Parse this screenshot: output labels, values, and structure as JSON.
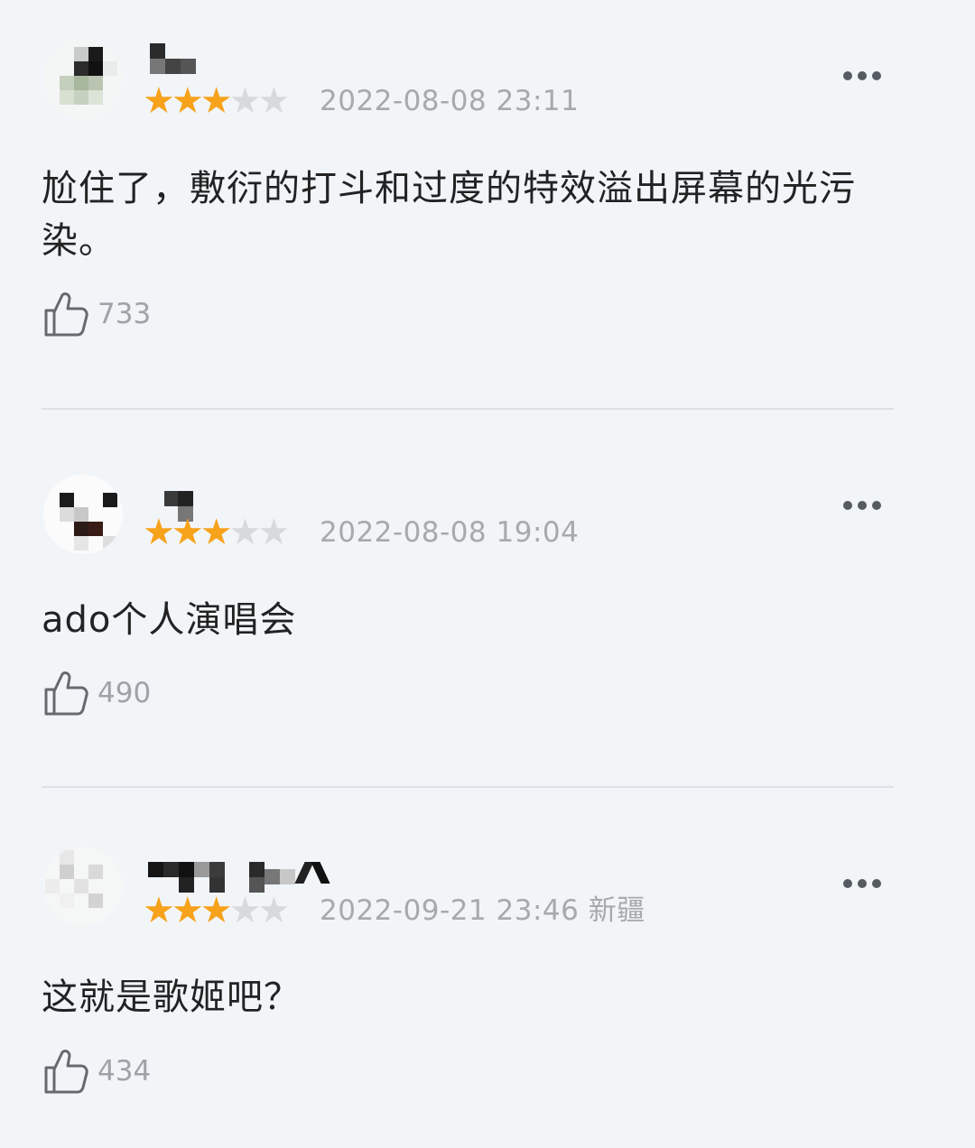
{
  "comments": [
    {
      "date": "2022-08-08 23:11",
      "rating": 3,
      "max_rating": 5,
      "text": "尬住了，敷衍的打斗和过度的特效溢出屏幕的光污染。",
      "likes": "733"
    },
    {
      "date": "2022-08-08 19:04",
      "rating": 3,
      "max_rating": 5,
      "text": "ado个人演唱会",
      "likes": "490"
    },
    {
      "date": "2022-09-21 23:46 新疆",
      "rating": 3,
      "max_rating": 5,
      "text": "这就是歌姬吧？",
      "likes": "434"
    }
  ],
  "icons": {
    "like": "thumbs-up-icon",
    "more": "more-dots-icon",
    "star": "star-icon"
  },
  "colors": {
    "star_filled": "#f7a21b",
    "star_empty": "#d7d9dc",
    "meta_text": "#a7a9ac",
    "background": "#f2f5f8"
  }
}
